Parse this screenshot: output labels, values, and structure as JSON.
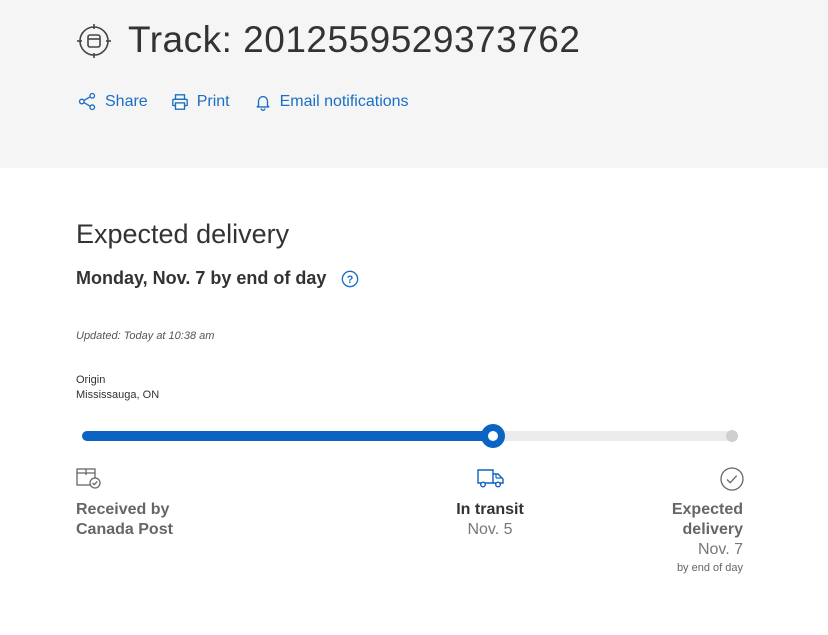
{
  "header": {
    "title": "Track: 2012559529373762",
    "actions": {
      "share": "Share",
      "print": "Print",
      "email": "Email notifications"
    }
  },
  "delivery": {
    "heading": "Expected delivery",
    "date_text": "Monday, Nov. 7 by end of day",
    "updated": "Updated: Today at 10:38 am"
  },
  "origin": {
    "label": "Origin",
    "city": "Mississauga, ON"
  },
  "progress": {
    "fraction": 0.626
  },
  "steps": [
    {
      "name": "Received by Canada Post",
      "line1": "Received by",
      "line2": "Canada Post",
      "icon": "package-check-icon"
    },
    {
      "name": "In transit",
      "date": "Nov. 5",
      "icon": "truck-icon"
    },
    {
      "line1": "Expected",
      "line2": "delivery",
      "date": "Nov. 7",
      "note": "by end of day",
      "icon": "check-circle-icon"
    }
  ],
  "colors": {
    "accent": "#0b63c4",
    "link": "#1a6fc4",
    "header_bg": "#f5f5f5"
  }
}
